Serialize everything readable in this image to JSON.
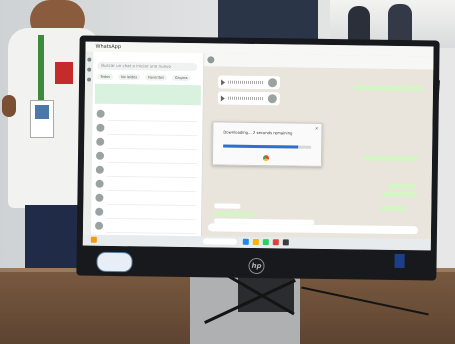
{
  "app": {
    "title": "WhatsApp",
    "search_placeholder": "Buscar un chat o iniciar uno nuevo",
    "filters": [
      "Todos",
      "No leídos",
      "Favoritos",
      "Grupos"
    ]
  },
  "download_dialog": {
    "status_text": "Downloading... 2 seconds remaining",
    "progress_percent": 85,
    "close_glyph": "✕"
  },
  "colors": {
    "accent": "#2da44e",
    "progress": "#2f6fd1",
    "monitor_bezel": "#18191c"
  },
  "icons": [
    "chrome-icon",
    "play-icon",
    "hp-logo-icon",
    "windows-start-icon"
  ],
  "monitor_brand": "hp"
}
